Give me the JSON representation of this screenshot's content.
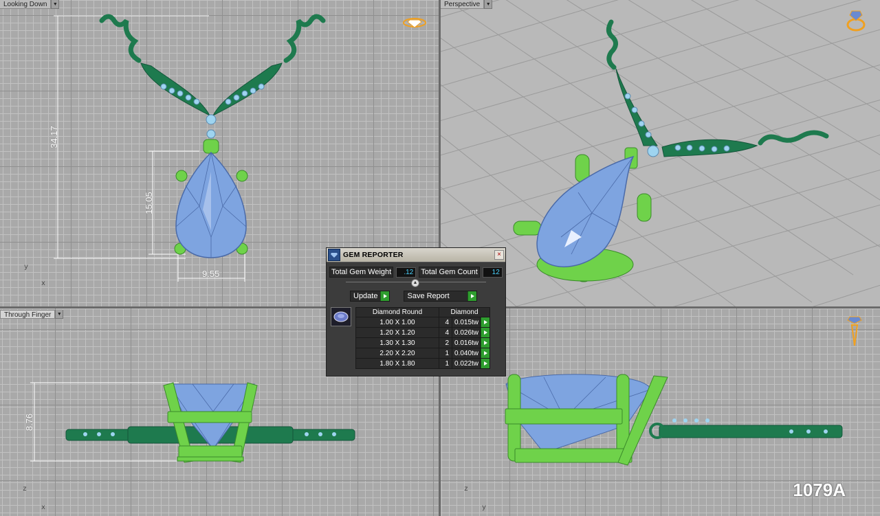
{
  "viewports": {
    "top_left": {
      "label": "Looking Down",
      "axis_v": "y",
      "axis_h": "x"
    },
    "top_right": {
      "label": "Perspective"
    },
    "bottom_left": {
      "label": "Through Finger",
      "axis_v": "z",
      "axis_h": "x"
    },
    "bottom_right": {
      "axis_v": "z",
      "axis_h": "y"
    }
  },
  "dimensions": {
    "overall_height": "34.17",
    "stone_height": "15.05",
    "stone_width": "9.55",
    "side_height": "8.76"
  },
  "design_code": "1079A",
  "gem_reporter": {
    "title": "GEM REPORTER",
    "total_weight_label": "Total Gem Weight",
    "total_weight_value": ".12",
    "total_count_label": "Total Gem Count",
    "total_count_value": "12",
    "update_label": "Update",
    "save_label": "Save Report",
    "col_shape": "Diamond Round",
    "col_material": "Diamond",
    "rows": [
      {
        "size": "1.00 X 1.00",
        "count": "4",
        "weight": "0.015tw"
      },
      {
        "size": "1.20 X 1.20",
        "count": "4",
        "weight": "0.026tw"
      },
      {
        "size": "1.30 X 1.30",
        "count": "2",
        "weight": "0.016tw"
      },
      {
        "size": "2.20 X 2.20",
        "count": "1",
        "weight": "0.040tw"
      },
      {
        "size": "1.80 X 1.80",
        "count": "1",
        "weight": "0.022tw"
      }
    ],
    "close_glyph": "×"
  },
  "colors": {
    "metal_dark": "#1e7a4e",
    "metal_light": "#6fd24a",
    "stone": "#7ea4e0",
    "accent_cyan": "#4ad4ff"
  },
  "icons": [
    "diamond-viewcube-icon",
    "ring-viewcube-icon",
    "gem-reporter-logo-icon",
    "close-icon",
    "play-arrow-icon"
  ]
}
